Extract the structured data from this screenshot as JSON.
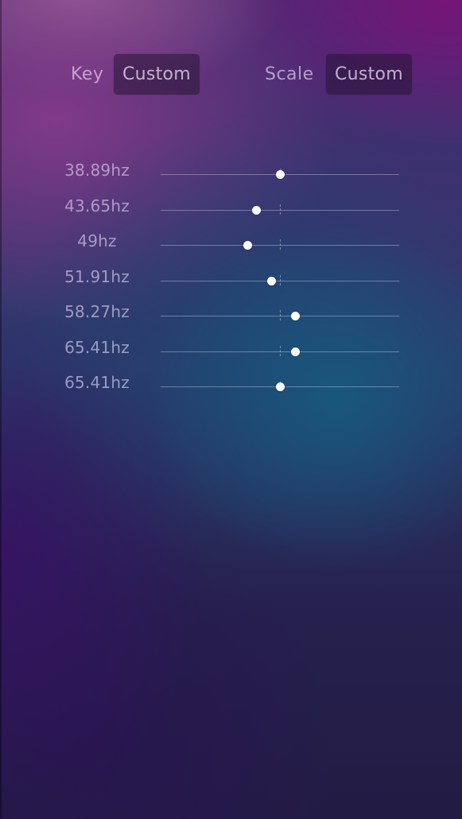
{
  "header": {
    "key_label": "Key",
    "key_value": "Custom",
    "scale_label": "Scale",
    "scale_value": "Custom"
  },
  "sliders": [
    {
      "label": "38.89hz",
      "level": 0.5
    },
    {
      "label": "43.65hz",
      "level": 0.4
    },
    {
      "label": "49hz",
      "level": 0.365
    },
    {
      "label": "51.91hz",
      "level": 0.465
    },
    {
      "label": "58.27hz",
      "level": 0.565
    },
    {
      "label": "65.41hz",
      "level": 0.565
    },
    {
      "label": "65.41hz",
      "level": 0.5
    }
  ]
}
